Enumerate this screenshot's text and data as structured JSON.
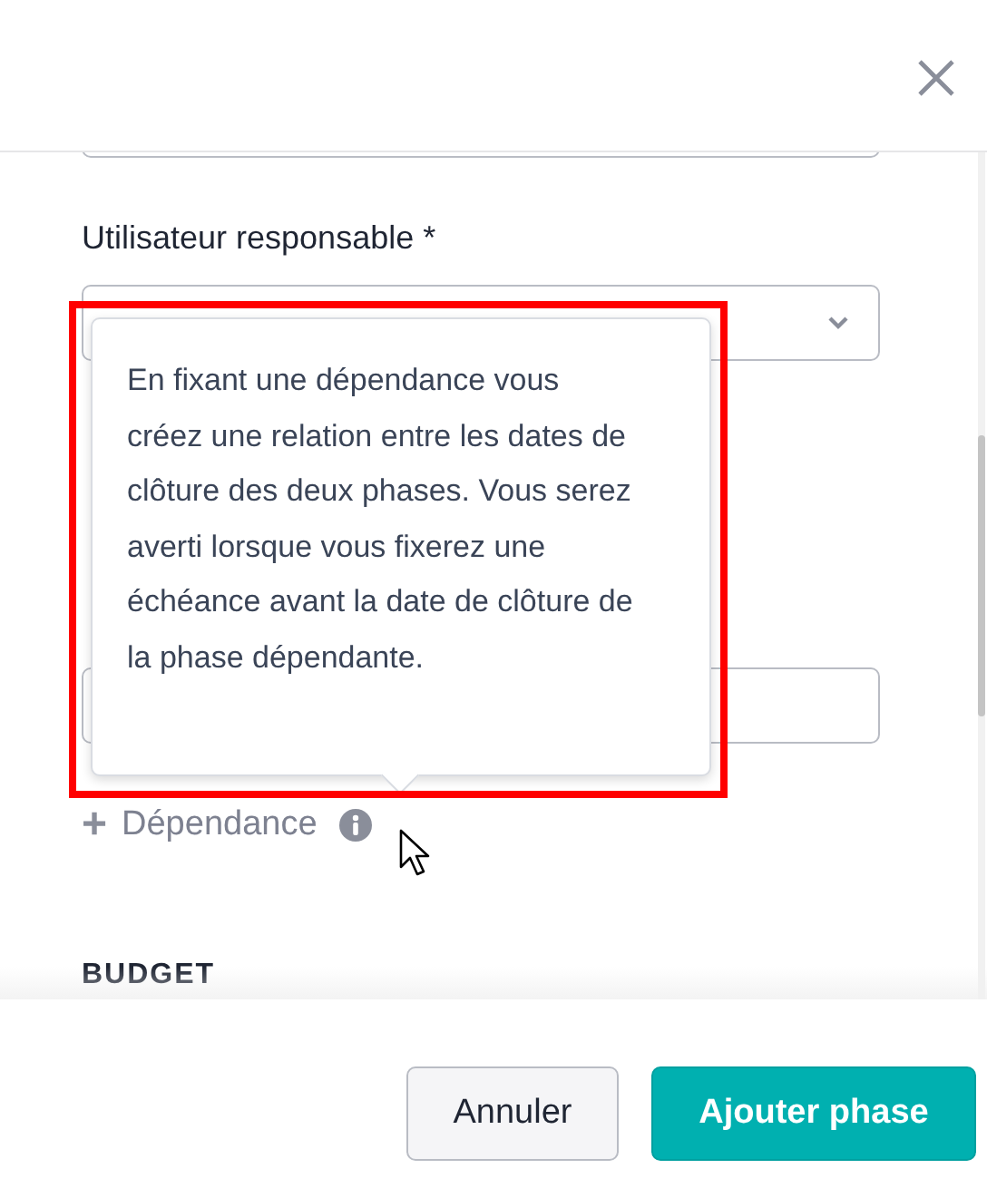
{
  "form": {
    "responsible_label": "Utilisateur responsable *",
    "dependency_sign": "+",
    "dependency_label": "Dépendance",
    "section_heading": "BUDGET"
  },
  "tooltip": {
    "text": "En fixant une dépendance vous créez une relation entre les dates de clôture des deux phases. Vous serez averti lorsque vous fixerez une échéance avant la date de clôture de la phase dépendante.",
    "highlighted": true
  },
  "buttons": [
    {
      "label": "Annuler",
      "kind": "secondary"
    },
    {
      "label": "Ajouter phase",
      "kind": "primary"
    }
  ]
}
